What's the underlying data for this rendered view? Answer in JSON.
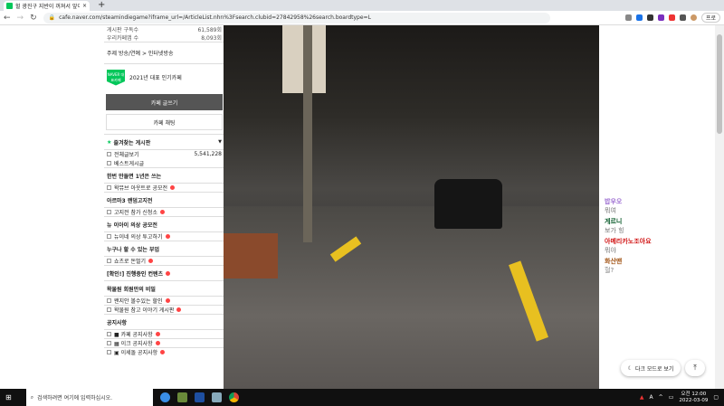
{
  "browser": {
    "tab_title": "헐 광진구 지반이 꺼져서 앞이 뜨",
    "url": "cafe.naver.com/steamindiegame?iframe_url=/ArticleList.nhn%3Fsearch.clubid=27842958%26search.boardtype=L",
    "profile": "프로"
  },
  "sidebar": {
    "stats": [
      {
        "label": "게시판 구독수",
        "value": "61,589회"
      },
      {
        "label": "우리카페앱 수",
        "value": "8,093회"
      }
    ],
    "topic": "주제  방송/연예 > 인터넷방송",
    "badge_text": "NAVER 대표카페",
    "award": "2021년 대표 인기카페",
    "write_button": "카페 글쓰기",
    "chat_button": "카페 채팅",
    "favorites": "즐겨찾는 게시판",
    "all_posts": "전체글보기",
    "all_count": "5,541,228",
    "best": "베스트게시글",
    "sections": [
      {
        "title": "한번 만들면 1년은 쓰는",
        "items": [
          "왁뮤브 아웃트로 공모전"
        ]
      },
      {
        "title": "아르마3 랜덤고지전",
        "items": [
          "고지전 참가 신청소"
        ]
      },
      {
        "title": "뉴 이아이 의상 공모전",
        "items": [
          "뉴이네 의상 투고하기"
        ]
      },
      {
        "title": "누구나 할 수 있는 부업",
        "items": [
          "쇼츠로 돈벌기"
        ]
      },
      {
        "title": "[확인!] 진행중인 컨텐츠",
        "items": []
      },
      {
        "title": "왁물원 회원만의 비밀",
        "items": [
          "왠지안 볼수있는 할인",
          "왁물원 참고 이야기 게시판"
        ]
      },
      {
        "title": "공지사항",
        "items": [
          "■ 카페 공지사항",
          "▦ 이크 공지사항",
          "▣ 이세돌 공지사항"
        ]
      }
    ]
  },
  "chat": [
    {
      "nick": "밥우오",
      "text": "뭐여",
      "color": "#9b6bd0"
    },
    {
      "nick": "게르니",
      "text": "보가 힝",
      "color": "#0a5a2a"
    },
    {
      "nick": "아메리카노조아요",
      "text": "뭐야",
      "color": "#d01010"
    },
    {
      "nick": "화산맨",
      "text": "헐?",
      "color": "#a05010"
    }
  ],
  "buttons": {
    "dark_mode": "다크 모드로 보기",
    "top": "⤒"
  },
  "taskbar": {
    "search_placeholder": "검색하려면 여기에 입력하십시오.",
    "ime": "A",
    "time": "오전 12:00",
    "date": "2022-03-09"
  }
}
